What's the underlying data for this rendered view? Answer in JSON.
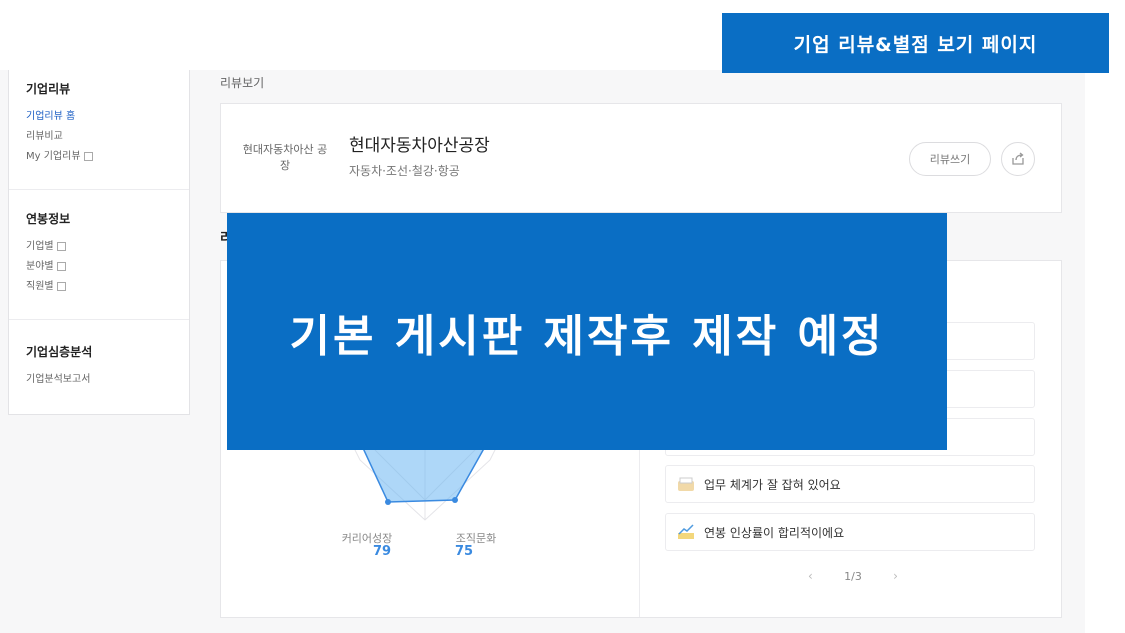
{
  "banner": {
    "title": "기업 리뷰&별점 보기 페이지"
  },
  "sidebar": {
    "sections": [
      {
        "title": "기업리뷰",
        "items": [
          {
            "label": "기업리뷰 홈",
            "active": true,
            "external": false
          },
          {
            "label": "리뷰비교",
            "active": false,
            "external": false
          },
          {
            "label": "My 기업리뷰",
            "active": false,
            "external": true
          }
        ]
      },
      {
        "title": "연봉정보",
        "items": [
          {
            "label": "기업별",
            "active": false,
            "external": true
          },
          {
            "label": "분야별",
            "active": false,
            "external": true
          },
          {
            "label": "직원별",
            "active": false,
            "external": true
          }
        ]
      },
      {
        "title": "기업심층분석",
        "items": [
          {
            "label": "기업분석보고서",
            "active": false,
            "external": false
          }
        ]
      }
    ]
  },
  "main": {
    "section_label": "리뷰보기",
    "company": {
      "logo_text": "현대자동차아산 공장",
      "name": "현대자동차아산공장",
      "industry": "자동차·조선·철강·항공",
      "write_review_label": "리뷰쓰기",
      "share_icon": "share-icon"
    },
    "rating_section_label_partial": "리",
    "radar": {
      "labels": [
        {
          "name": "커리어성장",
          "value": "79"
        },
        {
          "name": "조직문화",
          "value": "75"
        }
      ]
    },
    "tags": [
      {
        "icon": "tray-icon",
        "text": "업무 체계가 잘 잡혀 있어요"
      },
      {
        "icon": "growth-chart-icon",
        "text": "연봉 인상률이 합리적이에요"
      }
    ],
    "pager": {
      "current": "1/3"
    }
  },
  "overlay": {
    "text": "기본 게시판 제작후 제작 예정"
  },
  "colors": {
    "accent": "#0a6ec4",
    "active_link": "#1d5fc4",
    "radar_fill": "#6cb6f2"
  }
}
